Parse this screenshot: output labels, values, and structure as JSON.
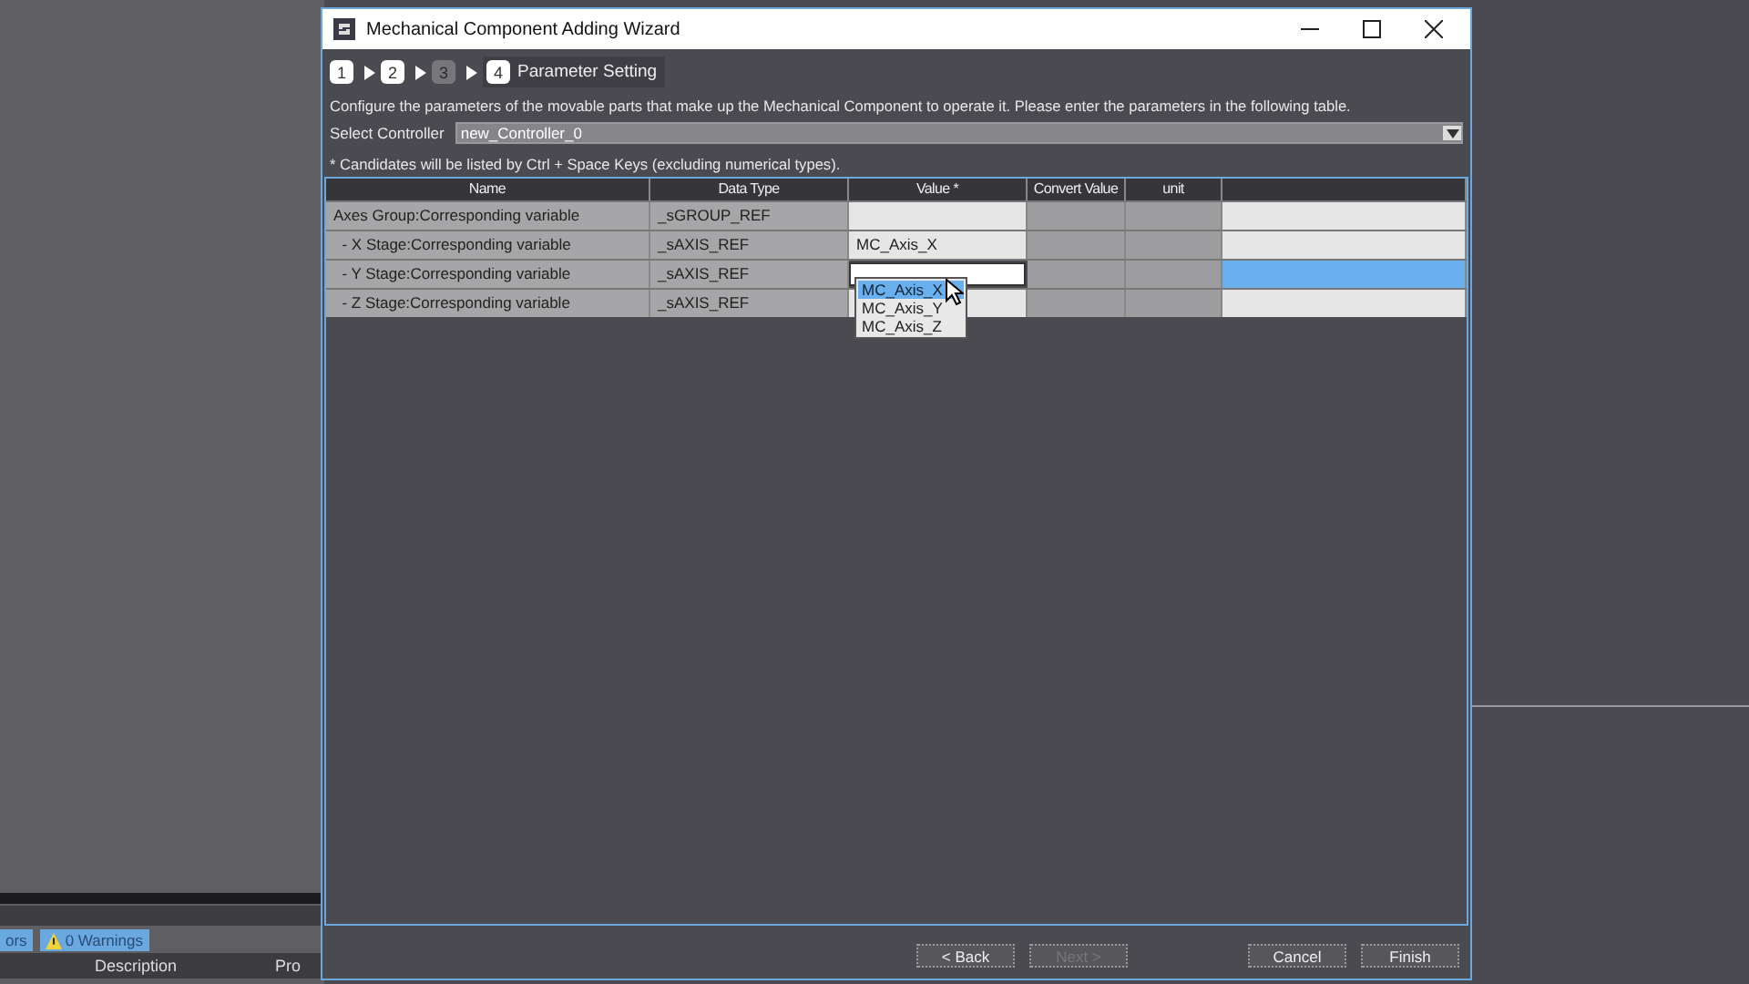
{
  "background_app": {
    "tabs": [
      {
        "label": "ors",
        "selected": true
      },
      {
        "label": "0 Warnings",
        "selected": true
      }
    ],
    "columns": [
      "Description",
      "Pro"
    ]
  },
  "window": {
    "title": "Mechanical Component Adding Wizard"
  },
  "steps": [
    {
      "number": "1",
      "disabled": false,
      "current": false
    },
    {
      "number": "2",
      "disabled": false,
      "current": false
    },
    {
      "number": "3",
      "disabled": true,
      "current": false
    },
    {
      "number": "4",
      "label": "Parameter Setting",
      "disabled": false,
      "current": true
    }
  ],
  "instruction": "Configure the parameters of the movable parts that make up the Mechanical Component to operate it. Please enter the parameters in the following table.",
  "controller": {
    "label": "Select Controller",
    "value": "new_Controller_0"
  },
  "hint": "* Candidates will be listed by Ctrl + Space Keys (excluding numerical types).",
  "table": {
    "columns": [
      "Name",
      "Data Type",
      "Value *",
      "Convert Value",
      "unit"
    ],
    "rows": [
      {
        "name": "Axes Group:Corresponding variable",
        "data_type": "_sGROUP_REF",
        "value": "",
        "editing": false,
        "selected": false
      },
      {
        "name": "  - X Stage:Corresponding variable",
        "data_type": "_sAXIS_REF",
        "value": "MC_Axis_X",
        "editing": false,
        "selected": false
      },
      {
        "name": "  - Y Stage:Corresponding variable",
        "data_type": "_sAXIS_REF",
        "value": "",
        "editing": true,
        "selected": true
      },
      {
        "name": "  - Z Stage:Corresponding variable",
        "data_type": "_sAXIS_REF",
        "value": "",
        "editing": false,
        "selected": false
      }
    ]
  },
  "suggestions": [
    {
      "label": "MC_Axis_X",
      "selected": true
    },
    {
      "label": "MC_Axis_Y",
      "selected": false
    },
    {
      "label": "MC_Axis_Z",
      "selected": false
    }
  ],
  "buttons": [
    {
      "label": "< Back",
      "disabled": false
    },
    {
      "label": "Next >",
      "disabled": true
    },
    {
      "label": "Cancel",
      "disabled": false
    },
    {
      "label": "Finish",
      "disabled": false
    }
  ]
}
